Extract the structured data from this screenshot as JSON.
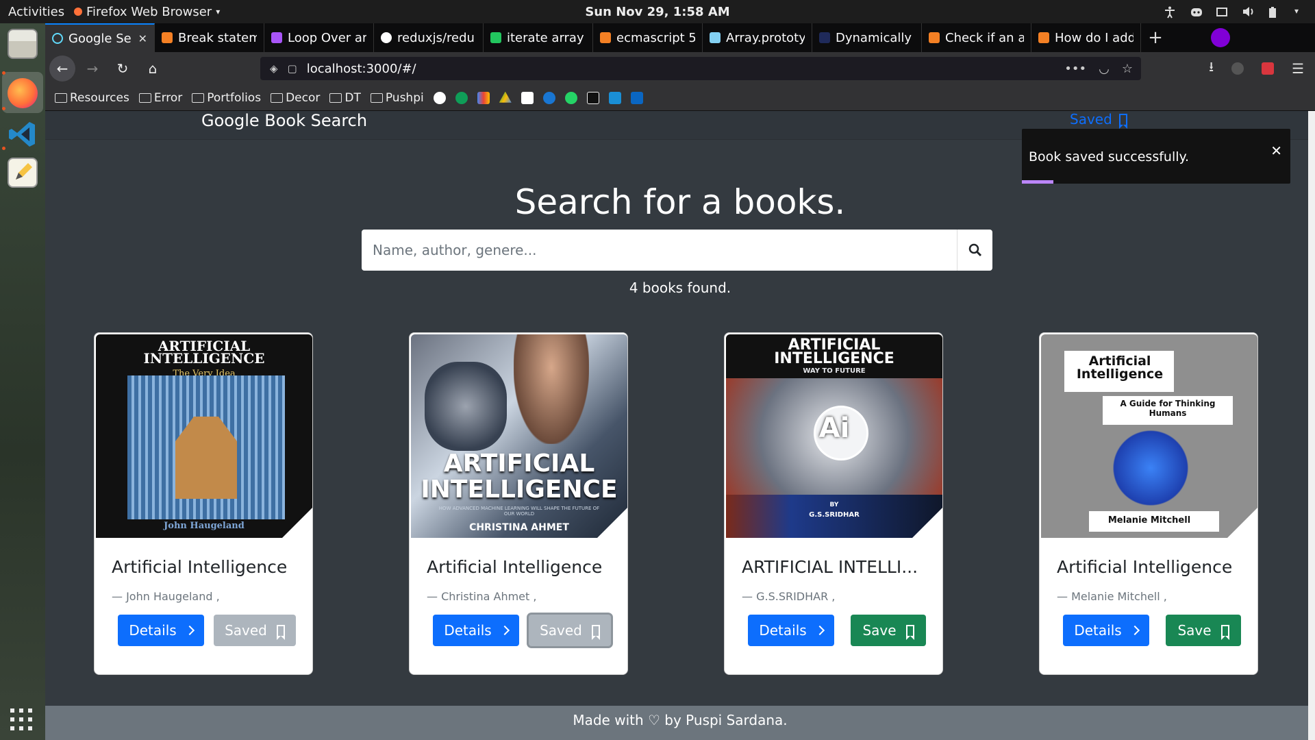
{
  "system": {
    "activities": "Activities",
    "app_menu": "Firefox Web Browser",
    "clock": "Sun Nov 29,  1:58 AM"
  },
  "browser": {
    "tabs": [
      {
        "title": "Google Se",
        "active": true
      },
      {
        "title": "Break statem"
      },
      {
        "title": "Loop Over ar"
      },
      {
        "title": "reduxjs/redu"
      },
      {
        "title": "iterate array"
      },
      {
        "title": "ecmascript 5"
      },
      {
        "title": "Array.prototy"
      },
      {
        "title": "Dynamically r"
      },
      {
        "title": "Check if an ar"
      },
      {
        "title": "How do I add"
      }
    ],
    "url": "localhost:3000/#/",
    "bookmarks": [
      {
        "label": "Resources"
      },
      {
        "label": "Error"
      },
      {
        "label": "Portfolios"
      },
      {
        "label": "Decor"
      },
      {
        "label": "DT"
      },
      {
        "label": "Pushpi"
      }
    ]
  },
  "app": {
    "brand": "Google Book Search",
    "saved_link": "Saved",
    "toast_message": "Book saved successfully.",
    "hero_title": "Search for a books.",
    "search_placeholder": "Name, author, genere...",
    "results_text": "4 books found.",
    "footer": "Made with ♡ by Puspi Sardana."
  },
  "books": [
    {
      "title": "Artificial Intelligence",
      "author": "— John Haugeland ,",
      "details": "Details",
      "action": "Saved",
      "saved": true
    },
    {
      "title": "Artificial Intelligence",
      "author": "— Christina Ahmet ,",
      "details": "Details",
      "action": "Saved",
      "saved": true
    },
    {
      "title": "ARTIFICIAL INTELLI...",
      "author": "— G.S.SRIDHAR ,",
      "details": "Details",
      "action": "Save",
      "saved": false
    },
    {
      "title": "Artificial Intelligence",
      "author": "— Melanie Mitchell ,",
      "details": "Details",
      "action": "Save",
      "saved": false
    }
  ],
  "covers": [
    {
      "line1": "ARTIFICIAL",
      "line2": "INTELLIGENCE",
      "line3": "The Very Idea",
      "line4": "John Haugeland"
    },
    {
      "line1": "ARTIFICIAL",
      "line2": "INTELLIGENCE",
      "line3": "HOW ADVANCED MACHINE LEARNING WILL SHAPE THE FUTURE OF OUR WORLD",
      "line4": "CHRISTINA AHMET"
    },
    {
      "line1": "ARTIFICIAL",
      "line2": "INTELLIGENCE",
      "line3": "WAY TO FUTURE",
      "line4": "Ai",
      "line5": "BY",
      "line6": "G.S.SRIDHAR"
    },
    {
      "line1": "Artificial",
      "line2": "Intelligence",
      "line3": "A Guide for Thinking Humans",
      "line4": "Melanie Mitchell"
    }
  ],
  "colors": {
    "page_bg": "#343a40",
    "primary": "#0d6efd",
    "success": "#198754",
    "secondary": "#adb5bd"
  }
}
